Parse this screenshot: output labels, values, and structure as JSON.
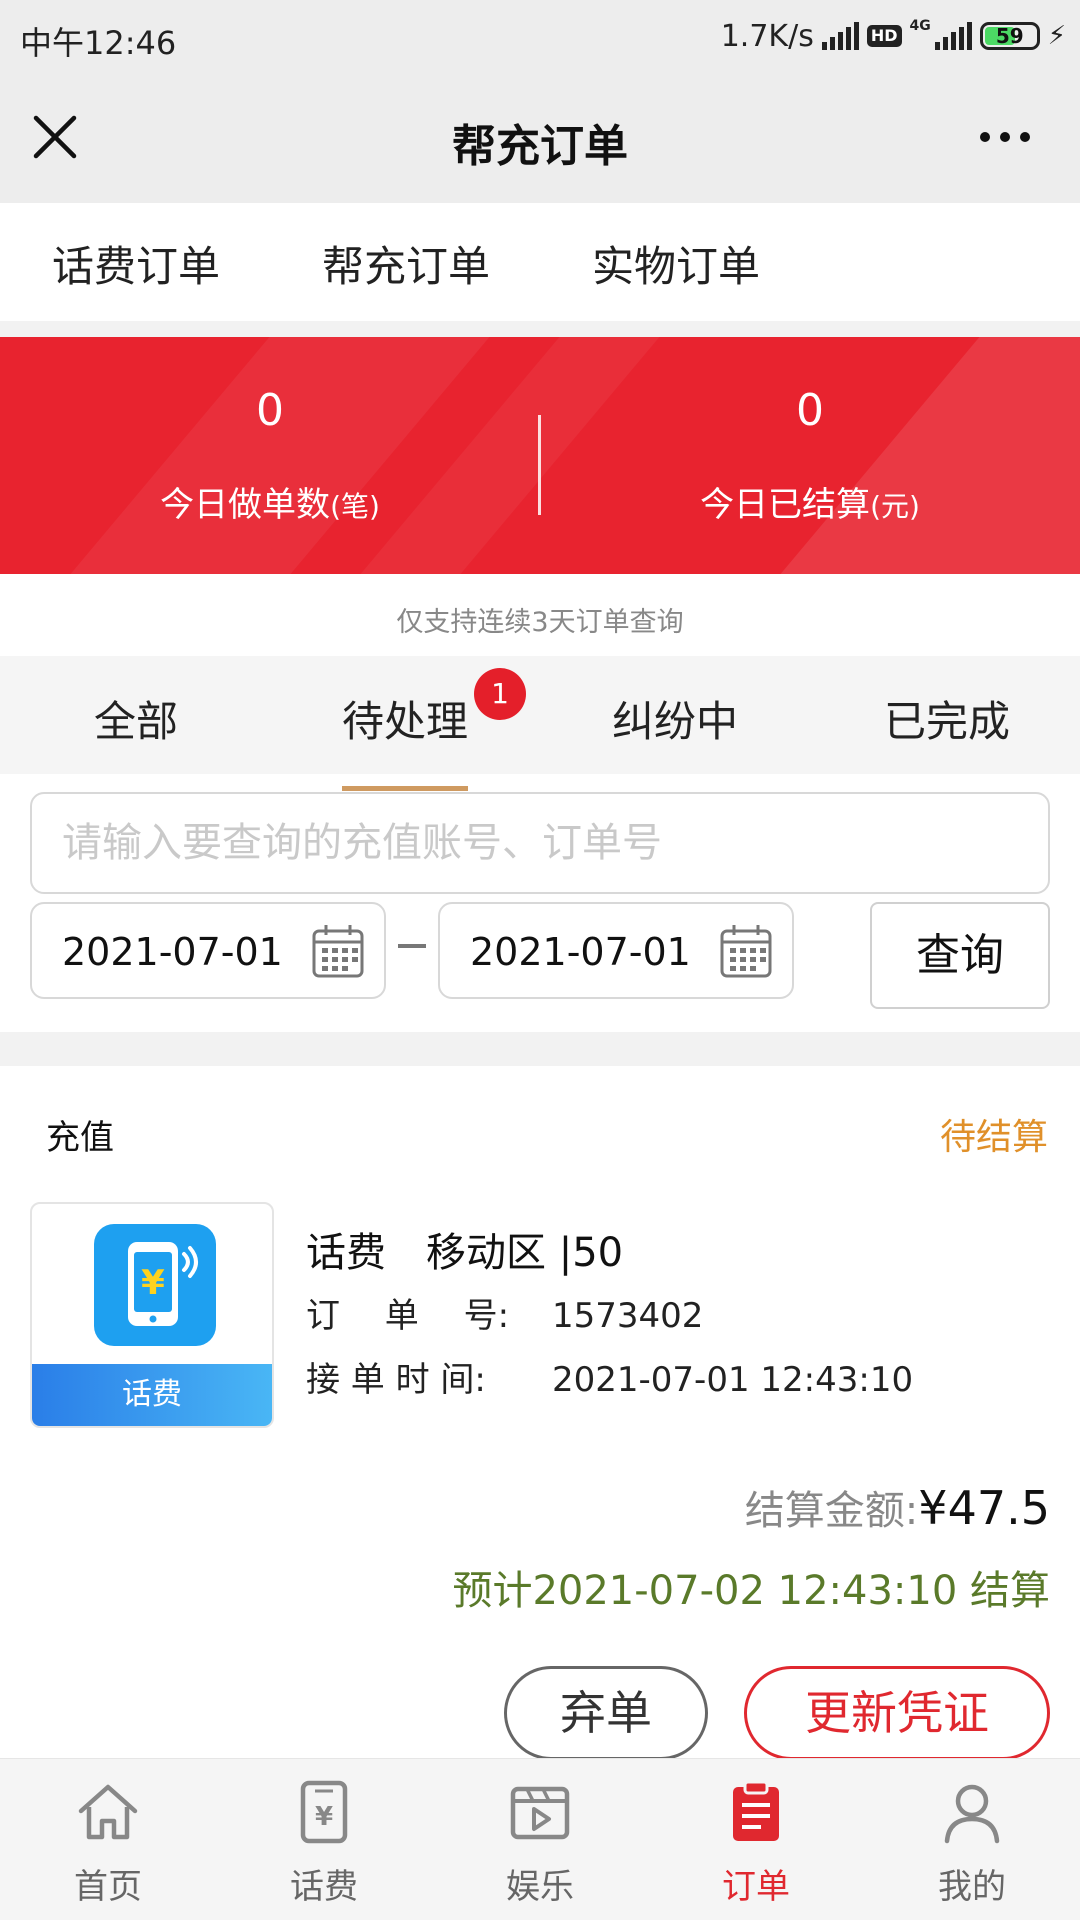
{
  "status_bar": {
    "time": "中午12:46",
    "net_speed": "1.7K/s",
    "hd": "HD",
    "network": "4G",
    "battery": "59"
  },
  "header": {
    "title": "帮充订单",
    "close_icon": "close-icon",
    "more_icon": "more-icon"
  },
  "top_tabs": [
    {
      "label": "话费订单",
      "active": false
    },
    {
      "label": "帮充订单",
      "active": true
    },
    {
      "label": "实物订单",
      "active": false
    }
  ],
  "banner": {
    "color": "#e8232f",
    "today_orders": {
      "value": "0",
      "label": "今日做单数",
      "unit": "(笔)"
    },
    "today_settled": {
      "value": "0",
      "label": "今日已结算",
      "unit": "(元)"
    }
  },
  "hint": "仅支持连续3天订单查询",
  "sub_tabs": [
    {
      "label": "全部",
      "active": false
    },
    {
      "label": "待处理",
      "active": true,
      "badge": "1"
    },
    {
      "label": "纠纷中",
      "active": false
    },
    {
      "label": "已完成",
      "active": false
    }
  ],
  "search": {
    "placeholder": "请输入要查询的充值账号、订单号",
    "value": "",
    "date_from": "2021-07-01",
    "date_to": "2021-07-01",
    "query_label": "查询"
  },
  "order": {
    "account_label": "充值",
    "status": "待结算",
    "thumb_label": "话费",
    "title": "话费　移动区 |50",
    "order_no_key": "订　 单 　号:",
    "order_no": "1573402",
    "time_key": "接 单 时 间:",
    "time": "2021-07-01 12:43:10",
    "amount_label": "结算金额:",
    "amount": "¥47.5",
    "eta": "预计2021-07-02 12:43:10 结算",
    "abandon_label": "弃单",
    "update_label": "更新凭证"
  },
  "bottom_nav": [
    {
      "label": "首页",
      "icon": "home-icon",
      "active": false
    },
    {
      "label": "话费",
      "icon": "phone-bill-icon",
      "active": false
    },
    {
      "label": "娱乐",
      "icon": "video-icon",
      "active": false
    },
    {
      "label": "订单",
      "icon": "order-icon",
      "active": true
    },
    {
      "label": "我的",
      "icon": "user-icon",
      "active": false
    }
  ],
  "colors": {
    "accent_red": "#e0282f",
    "tab_underline": "#cf9a60",
    "status_orange": "#e0902a",
    "eta_green": "#5a7a2a"
  }
}
